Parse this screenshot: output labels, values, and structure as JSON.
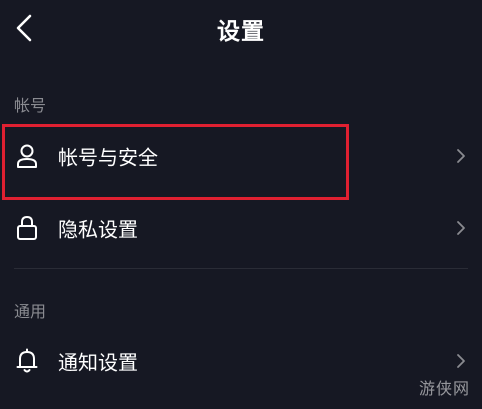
{
  "header": {
    "title": "设置",
    "back_icon": "chevron-left-icon"
  },
  "sections": [
    {
      "label": "帐号",
      "items": [
        {
          "label": "帐号与安全",
          "icon": "user-icon",
          "highlighted": true
        },
        {
          "label": "隐私设置",
          "icon": "lock-icon",
          "highlighted": false
        }
      ]
    },
    {
      "label": "通用",
      "items": [
        {
          "label": "通知设置",
          "icon": "bell-icon",
          "highlighted": false
        }
      ]
    }
  ],
  "watermark": "游侠网",
  "colors": {
    "background": "#161823",
    "highlight": "#e02031",
    "secondary_text": "#8a8b91"
  }
}
